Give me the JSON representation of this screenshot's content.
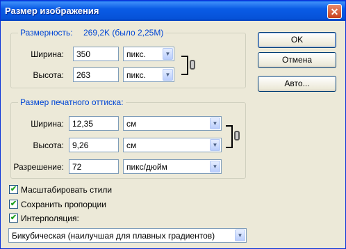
{
  "window": {
    "title": "Размер изображения",
    "close_glyph": "✕"
  },
  "pixel_dims": {
    "legend": "Размерность:",
    "size_text": "269,2K (было 2,25M)",
    "width": {
      "label": "Ширина:",
      "value": "350",
      "unit": "пикс."
    },
    "height": {
      "label": "Высота:",
      "value": "263",
      "unit": "пикс."
    }
  },
  "doc_size": {
    "legend": "Размер печатного оттиска:",
    "width": {
      "label": "Ширина:",
      "value": "12,35",
      "unit": "см"
    },
    "height": {
      "label": "Высота:",
      "value": "9,26",
      "unit": "см"
    },
    "resolution": {
      "label": "Разрешение:",
      "value": "72",
      "unit": "пикс/дюйм"
    }
  },
  "options": [
    {
      "label": "Масштабировать стили",
      "checked": true
    },
    {
      "label": "Сохранить пропорции",
      "checked": true
    },
    {
      "label": "Интерполяция:",
      "checked": true
    }
  ],
  "interpolation": {
    "value": "Бикубическая (наилучшая для плавных градиентов)"
  },
  "buttons": {
    "ok": "OK",
    "cancel": "Отмена",
    "auto": "Авто..."
  },
  "icons": {
    "link": "chain-link-icon",
    "dropdown": "chevron-down-icon",
    "check": "checkmark-icon"
  },
  "colors": {
    "legend_text": "#0046d5",
    "titlebar": "#0a5ce6",
    "check": "#21a121"
  }
}
